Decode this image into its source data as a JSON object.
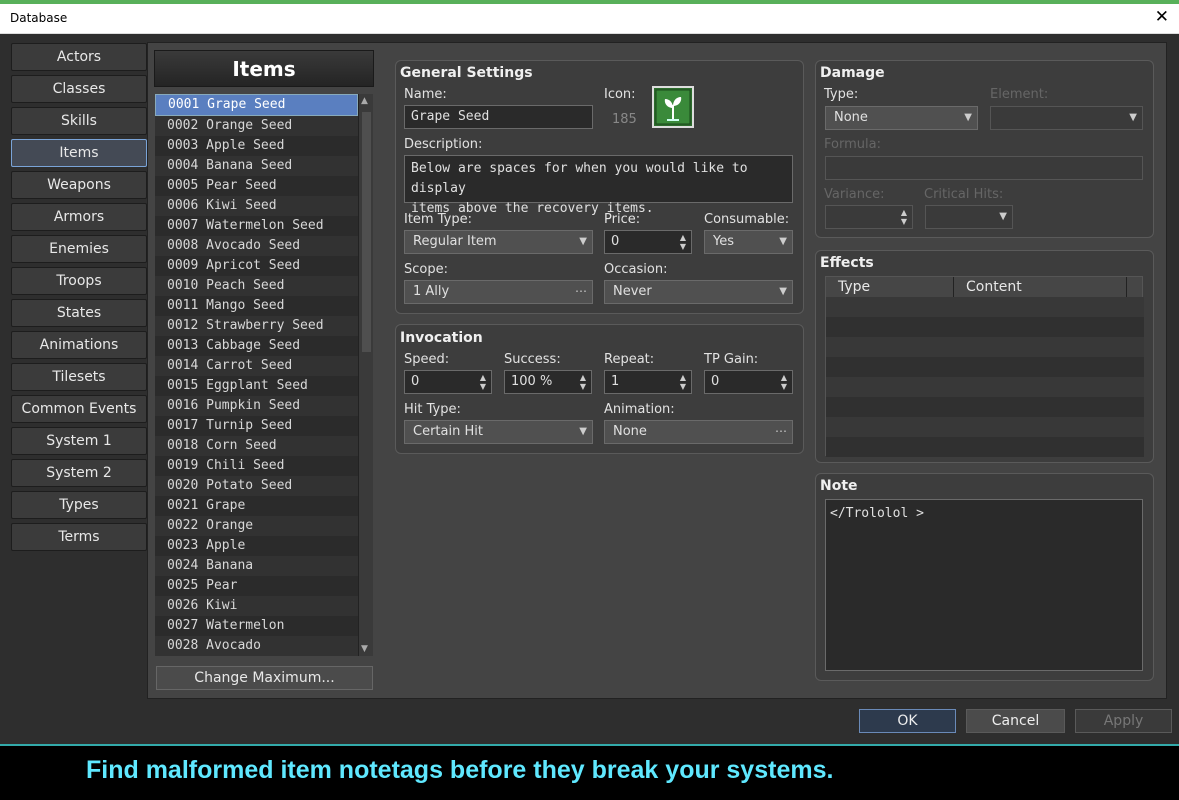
{
  "window": {
    "title": "Database",
    "close_glyph": "✕"
  },
  "tabs": [
    "Actors",
    "Classes",
    "Skills",
    "Items",
    "Weapons",
    "Armors",
    "Enemies",
    "Troops",
    "States",
    "Animations",
    "Tilesets",
    "Common Events",
    "System 1",
    "System 2",
    "Types",
    "Terms"
  ],
  "selected_tab": "Items",
  "list": {
    "header": "Items",
    "rows": [
      "0001 Grape Seed",
      "0002 Orange Seed",
      "0003 Apple Seed",
      "0004 Banana Seed",
      "0005 Pear Seed",
      "0006 Kiwi Seed",
      "0007 Watermelon Seed",
      "0008 Avocado Seed",
      "0009 Apricot Seed",
      "0010 Peach Seed",
      "0011 Mango Seed",
      "0012 Strawberry Seed",
      "0013 Cabbage Seed",
      "0014 Carrot Seed",
      "0015 Eggplant Seed",
      "0016 Pumpkin Seed",
      "0017 Turnip Seed",
      "0018 Corn Seed",
      "0019 Chili Seed",
      "0020 Potato Seed",
      "0021 Grape",
      "0022 Orange",
      "0023 Apple",
      "0024 Banana",
      "0025 Pear",
      "0026 Kiwi",
      "0027 Watermelon",
      "0028 Avocado"
    ],
    "selected_index": 0,
    "change_max": "Change Maximum..."
  },
  "general": {
    "title": "General Settings",
    "name_label": "Name:",
    "name_value": "Grape Seed",
    "icon_label": "Icon:",
    "icon_index": "185",
    "desc_label": "Description:",
    "desc_line1": "Below are spaces for when you would like to display",
    "desc_line2": "items above the recovery items.",
    "item_type_label": "Item Type:",
    "item_type": "Regular Item",
    "price_label": "Price:",
    "price": "0",
    "consumable_label": "Consumable:",
    "consumable": "Yes",
    "scope_label": "Scope:",
    "scope": "1 Ally",
    "occasion_label": "Occasion:",
    "occasion": "Never"
  },
  "invocation": {
    "title": "Invocation",
    "speed_label": "Speed:",
    "speed": "0",
    "success_label": "Success:",
    "success": "100 %",
    "repeat_label": "Repeat:",
    "repeat": "1",
    "tp_label": "TP Gain:",
    "tp": "0",
    "hit_type_label": "Hit Type:",
    "hit_type": "Certain Hit",
    "animation_label": "Animation:",
    "animation": "None"
  },
  "damage": {
    "title": "Damage",
    "type_label": "Type:",
    "type": "None",
    "element_label": "Element:",
    "formula_label": "Formula:",
    "variance_label": "Variance:",
    "critical_label": "Critical Hits:"
  },
  "effects": {
    "title": "Effects",
    "col_type": "Type",
    "col_content": "Content"
  },
  "note": {
    "title": "Note",
    "text": "</Trololol >"
  },
  "buttons": {
    "ok": "OK",
    "cancel": "Cancel",
    "apply": "Apply"
  },
  "caption": "Find malformed item notetags before they break your systems.",
  "colors": {
    "accent": "#5a7fc0",
    "caption": "#5fe8ff",
    "icon_bg": "#2d6b2d"
  },
  "icons": {
    "item_icon": "sprout-icon",
    "dropdown": "chevron-down-icon",
    "ellipsis": "ellipsis-icon",
    "spinner": "spinner-arrows-icon"
  }
}
